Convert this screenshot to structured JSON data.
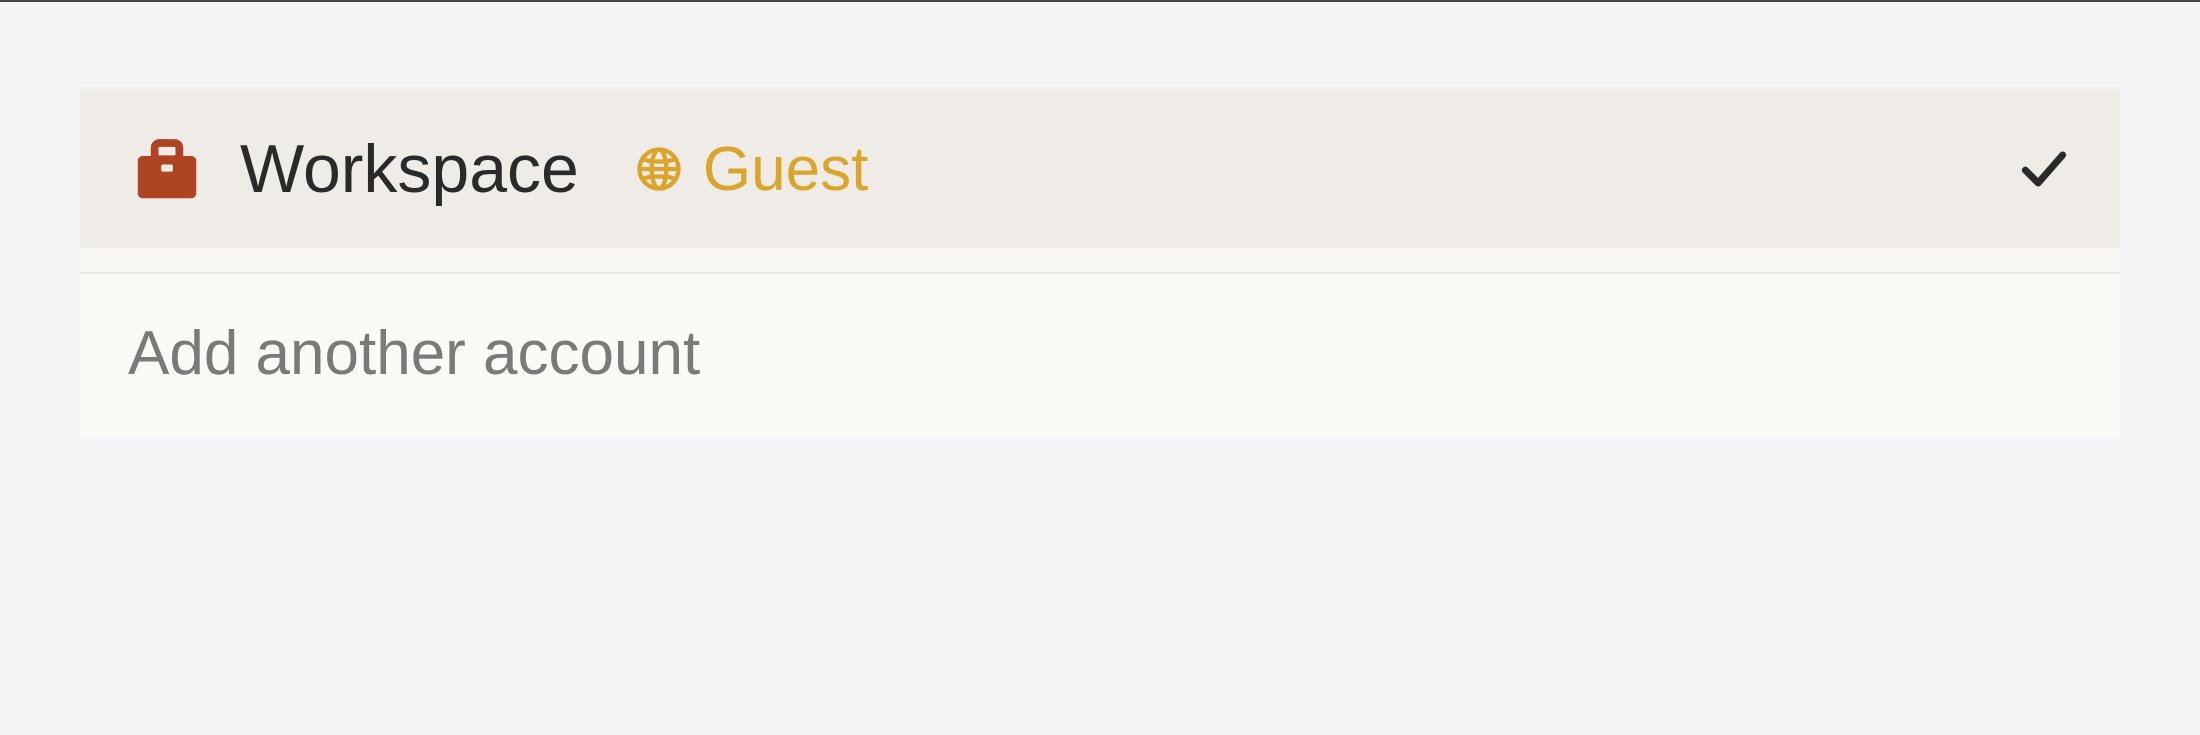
{
  "workspace": {
    "name": "Workspace",
    "role_label": "Guest",
    "selected": true
  },
  "actions": {
    "add_account_label": "Add another account"
  },
  "colors": {
    "briefcase": "#af4424",
    "guest": "#dba52b",
    "check": "#2a2a2a"
  }
}
